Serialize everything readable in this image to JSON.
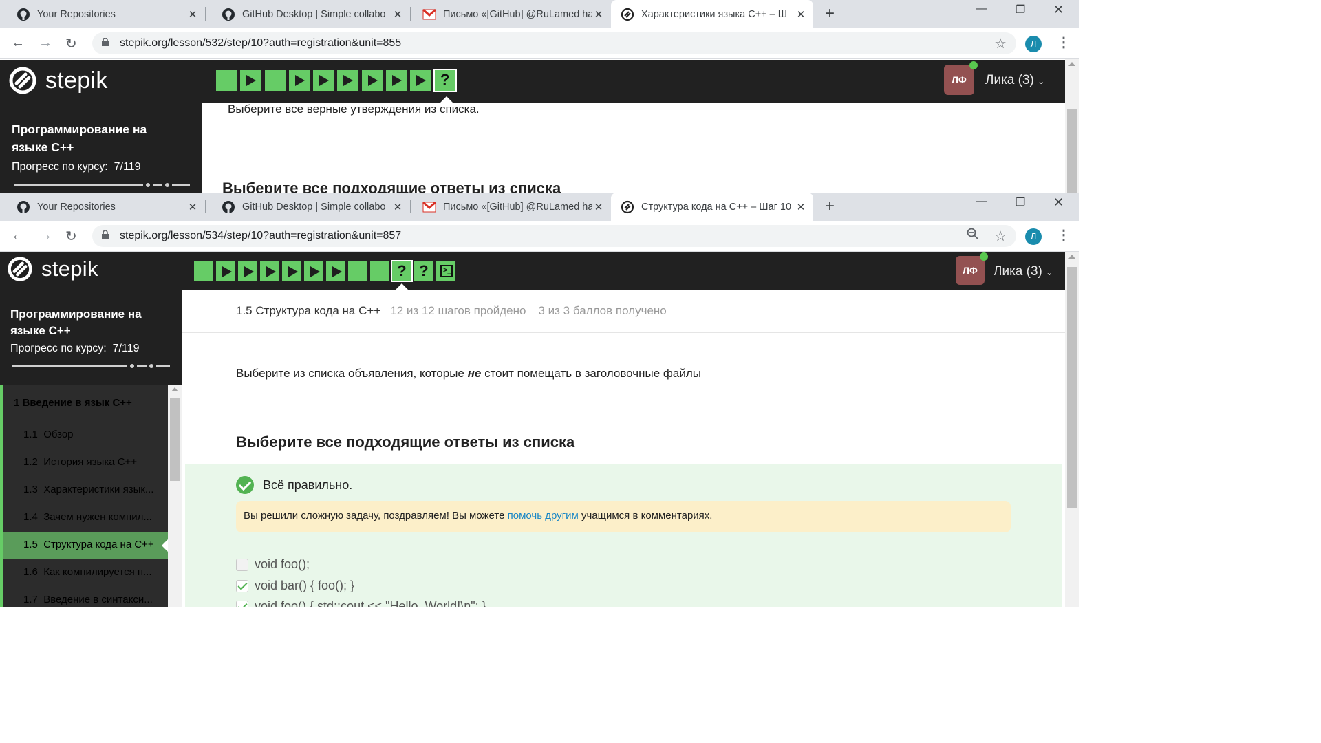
{
  "window1": {
    "tabs": [
      {
        "label": "Your Repositories",
        "icon": "github-icon"
      },
      {
        "label": "GitHub Desktop | Simple collabo",
        "icon": "github-icon"
      },
      {
        "label": "Письмо «[GitHub] @RuLamed ha",
        "icon": "gmail-icon"
      },
      {
        "label": "Характеристики языка C++ – Ш",
        "icon": "stepik-icon"
      }
    ],
    "url": "stepik.org/lesson/532/step/10?auth=registration&unit=855",
    "profile_initial": "Л",
    "header": {
      "logo": "stepik",
      "avatar": "ЛФ",
      "user": "Лика (3)"
    },
    "sidebar": {
      "course_title_line1": "Программирование на",
      "course_title_line2": "языке C++",
      "progress_label": "Прогресс по курсу:",
      "progress_value": "7/119",
      "progress_fraction": 0.06
    },
    "content": {
      "question": "Выберите все верные утверждения из списка.",
      "heading": "Выберите все подходящие ответы из списка"
    }
  },
  "window2": {
    "tabs": [
      {
        "label": "Your Repositories",
        "icon": "github-icon"
      },
      {
        "label": "GitHub Desktop | Simple collabo",
        "icon": "github-icon"
      },
      {
        "label": "Письмо «[GitHub] @RuLamed ha",
        "icon": "gmail-icon"
      },
      {
        "label": "Структура кода на C++ – Шаг 10",
        "icon": "stepik-icon"
      }
    ],
    "url": "stepik.org/lesson/534/step/10?auth=registration&unit=857",
    "profile_initial": "Л",
    "header": {
      "logo": "stepik",
      "avatar": "ЛФ",
      "user": "Лика (3)"
    },
    "sidebar": {
      "course_title_line1": "Программирование на",
      "course_title_line2": "языке C++",
      "progress_label": "Прогресс по курсу:",
      "progress_value": "7/119",
      "progress_fraction": 0.06,
      "section": "1  Введение в язык C++",
      "items": [
        {
          "num": "1.1",
          "title": "Обзор"
        },
        {
          "num": "1.2",
          "title": "История языка C++"
        },
        {
          "num": "1.3",
          "title": "Характеристики язык..."
        },
        {
          "num": "1.4",
          "title": "Зачем нужен компил..."
        },
        {
          "num": "1.5",
          "title": "Структура кода на C++"
        },
        {
          "num": "1.6",
          "title": "Как компилируется п..."
        },
        {
          "num": "1.7",
          "title": "Введение в синтакси..."
        }
      ]
    },
    "content": {
      "lesson_title": "1.5 Структура кода на C++",
      "steps_done": "12 из 12 шагов пройдено",
      "score": "3 из 3 баллов  получено",
      "question_before": "Выберите из списка объявления, которые ",
      "question_emph": "не",
      "question_after": " стоит помещать в заголовочные файлы",
      "heading": "Выберите все подходящие ответы из списка",
      "result": "Всё правильно.",
      "notice_before": "Вы решили сложную задачу, поздравляем! Вы можете ",
      "notice_link": "помочь другим",
      "notice_after": " учащимся в комментариях.",
      "options": [
        {
          "text": "void foo();",
          "checked": false
        },
        {
          "text": "void bar() { foo(); }",
          "checked": true
        },
        {
          "text": "void foo() { std::cout << \"Hello, World!\\n\"; }",
          "checked": true
        }
      ]
    }
  },
  "colors": {
    "accent_green": "#66cc66",
    "header_bg": "#212121",
    "link": "#1a87c6",
    "avatar_bg": "#935151"
  }
}
